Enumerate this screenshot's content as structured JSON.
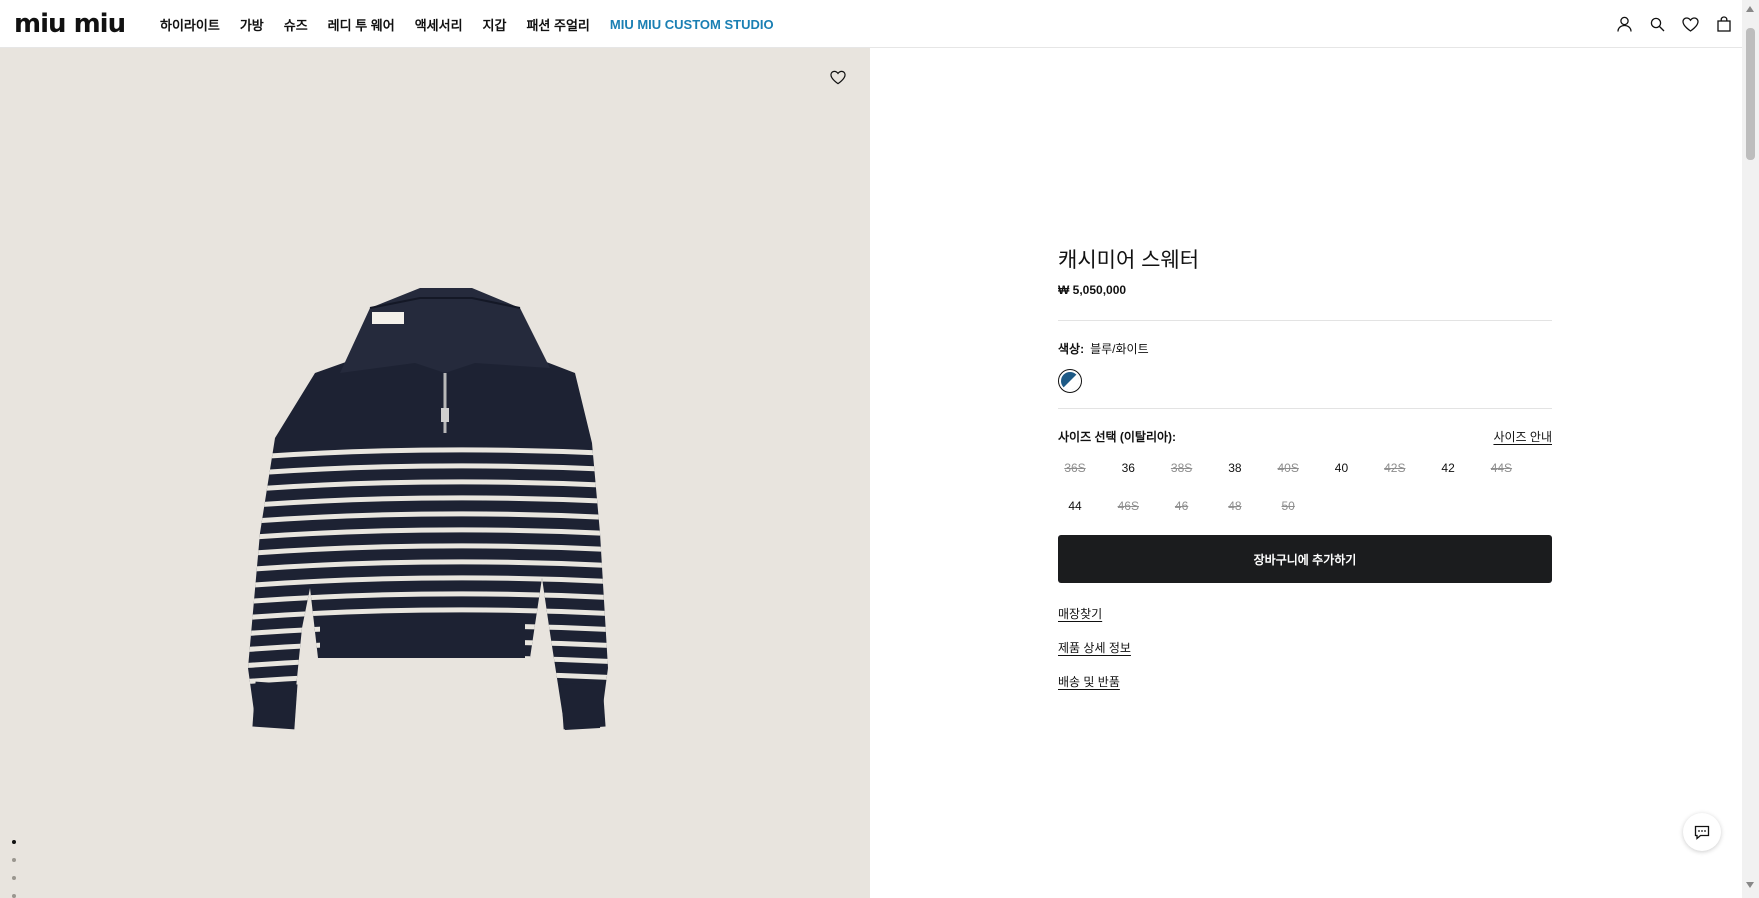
{
  "brand": {
    "logo_text": "miu miu"
  },
  "nav": {
    "items": [
      "하이라이트",
      "가방",
      "슈즈",
      "레디 투 웨어",
      "액세서리",
      "지갑",
      "패션 주얼리"
    ],
    "accent_item": "MIU MIU CUSTOM STUDIO",
    "accent_color": "#1a7fb3"
  },
  "header_icons": [
    "user-icon",
    "search-icon",
    "heart-icon",
    "bag-icon"
  ],
  "product": {
    "title": "캐시미어 스웨터",
    "price": "₩ 5,050,000",
    "color_label": "색상:",
    "color_value": "블루/화이트",
    "size_label": "사이즈 선택 (이탈리아):",
    "size_guide": "사이즈 안내",
    "sizes": [
      {
        "label": "36S",
        "available": false
      },
      {
        "label": "36",
        "available": true
      },
      {
        "label": "38S",
        "available": false
      },
      {
        "label": "38",
        "available": true
      },
      {
        "label": "40S",
        "available": false
      },
      {
        "label": "40",
        "available": true
      },
      {
        "label": "42S",
        "available": false
      },
      {
        "label": "42",
        "available": true
      },
      {
        "label": "44S",
        "available": false
      },
      {
        "label": "44",
        "available": true
      },
      {
        "label": "46S",
        "available": false
      },
      {
        "label": "46",
        "available": false
      },
      {
        "label": "48",
        "available": false
      },
      {
        "label": "50",
        "available": false
      }
    ],
    "add_to_cart": "장바구니에 추가하기",
    "links": [
      "매장찾기",
      "제품 상세 정보",
      "배송 및 반품"
    ]
  },
  "gallery": {
    "image_count": 5,
    "active_index": 0
  },
  "colors": {
    "button_bg": "#1b1c1e",
    "image_bg": "#e8e4de",
    "sweater_navy": "#1d2233",
    "stripe": "#e9e6df"
  }
}
